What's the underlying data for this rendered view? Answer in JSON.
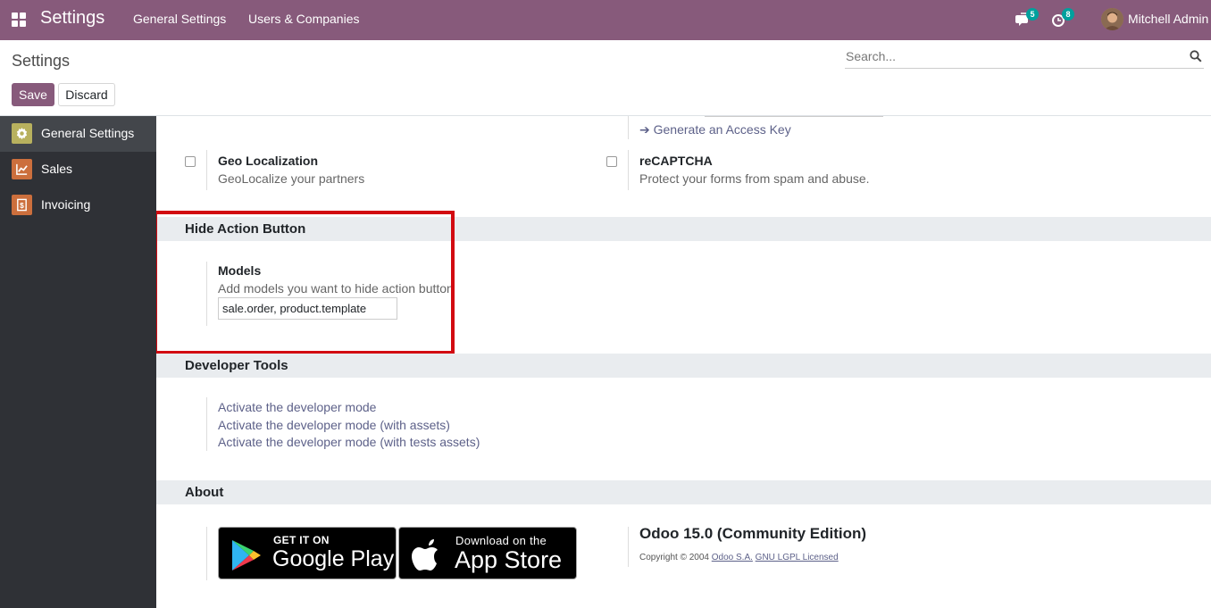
{
  "navbar": {
    "app_title": "Settings",
    "menu": [
      "General Settings",
      "Users & Companies"
    ],
    "messages_count": "5",
    "activities_count": "8",
    "user_name": "Mitchell Admin",
    "brand_color": "#875a7b"
  },
  "control_panel": {
    "title": "Settings",
    "search_placeholder": "Search...",
    "save_label": "Save",
    "discard_label": "Discard"
  },
  "sidebar": {
    "items": [
      {
        "label": "General Settings",
        "icon": "gear-icon",
        "color": "#b8b15e"
      },
      {
        "label": "Sales",
        "icon": "chart-icon",
        "color": "#cc6f3d"
      },
      {
        "label": "Invoicing",
        "icon": "invoice-icon",
        "color": "#cc6f3d"
      }
    ]
  },
  "main": {
    "generate_key_link": "Generate an Access Key",
    "geo": {
      "title": "Geo Localization",
      "desc": "GeoLocalize your partners"
    },
    "recaptcha": {
      "title": "reCAPTCHA",
      "desc": "Protect your forms from spam and abuse."
    },
    "hide_action": {
      "section_title": "Hide Action Button",
      "models_title": "Models",
      "models_desc": "Add models you want to hide action button",
      "models_value": "sale.order, product.template"
    },
    "developer": {
      "section_title": "Developer Tools",
      "links": [
        "Activate the developer mode",
        "Activate the developer mode (with assets)",
        "Activate the developer mode (with tests assets)"
      ]
    },
    "about": {
      "section_title": "About",
      "google_small": "GET IT ON",
      "google_big": "Google Play",
      "apple_small": "Download on the",
      "apple_big": "App Store",
      "version": "Odoo 15.0 (Community Edition)",
      "copyright": "Copyright © 2004",
      "company_link": "Odoo S.A.",
      "license_link": "GNU LGPL Licensed"
    }
  }
}
